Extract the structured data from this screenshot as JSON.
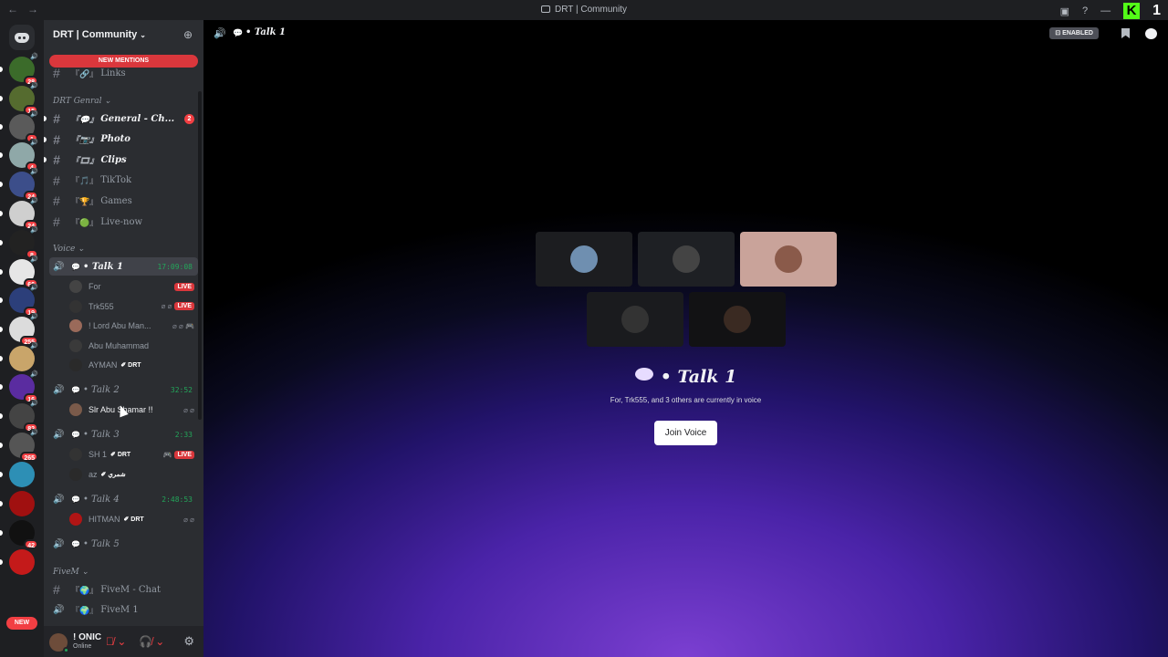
{
  "titlebar": {
    "title": "DRT | Community",
    "back": "←",
    "forward": "→",
    "k_logo": "K",
    "k_count": "1"
  },
  "servers": [
    {
      "badge": "28",
      "color": "#3b6b2a",
      "top": 0
    },
    {
      "badge": "15",
      "color": "#556b2f",
      "top": 0
    },
    {
      "badge": "1",
      "color": "#5a5a5a",
      "top": 0
    },
    {
      "badge": "4",
      "color": "#8fa8a8",
      "top": 0
    },
    {
      "badge": "24",
      "color": "#3c4e8a",
      "top": 0
    },
    {
      "badge": "24",
      "color": "#cfcfcf",
      "top": 0
    },
    {
      "badge": "8",
      "color": "#222",
      "top": 0
    },
    {
      "badge": "66",
      "color": "#e6e6e6",
      "top": 0
    },
    {
      "badge": "19",
      "color": "#2c3f7a",
      "top": 0
    },
    {
      "badge": "255",
      "color": "#dcdcdc",
      "top": 0
    },
    {
      "badge": "",
      "color": "#c9a56a",
      "top": 0
    },
    {
      "badge": "16",
      "color": "#5a2ca0",
      "top": 0
    },
    {
      "badge": "82",
      "color": "#444",
      "top": 0
    },
    {
      "badge": "265",
      "color": "#555",
      "top": 0
    },
    {
      "badge": "",
      "color": "#2d8fb5",
      "top": 0
    },
    {
      "badge": "",
      "color": "#a01010",
      "top": 0
    },
    {
      "badge": "42",
      "color": "#111",
      "top": 0
    },
    {
      "badge": "",
      "color": "#c41a1a",
      "top": 0
    }
  ],
  "new_label": "NEW",
  "guild": {
    "name": "DRT | Community"
  },
  "new_mentions": "NEW MENTIONS",
  "top_channels": [
    {
      "emoji": "『🔗』",
      "name": "Links"
    }
  ],
  "categories": {
    "general": "DRT Genral",
    "voice": "Voice",
    "fivem": "FiveM"
  },
  "general_channels": [
    {
      "emoji": "『💬』",
      "name": "General - Ch...",
      "count": "2",
      "unread": true
    },
    {
      "emoji": "『📷』",
      "name": "Photo",
      "count": "",
      "unread": true
    },
    {
      "emoji": "『🎞』",
      "name": "Clips",
      "count": "",
      "unread": true
    },
    {
      "emoji": "『🎵』",
      "name": "TikTok",
      "count": "",
      "unread": false
    },
    {
      "emoji": "『🏆』",
      "name": "Games",
      "count": "",
      "unread": false
    },
    {
      "emoji": "『🟢』",
      "name": "Live-now",
      "count": "",
      "unread": false
    }
  ],
  "voice": {
    "talk1": {
      "name": "• Talk 1",
      "time": "17:09:08"
    },
    "talk1_members": [
      {
        "name": "For",
        "tag": "",
        "live": "LIVE",
        "icons": "",
        "color": "#444"
      },
      {
        "name": "Trk555",
        "tag": "",
        "live": "LIVE",
        "icons": "⌀ ⌀",
        "color": "#333"
      },
      {
        "name": "! Lord Abu Man...",
        "tag": "",
        "live": "",
        "icons": "⌀ ⌀ 🎮",
        "color": "#9a6a5a"
      },
      {
        "name": "Abu Muhammad",
        "tag": "",
        "live": "",
        "icons": "",
        "color": "#3a3a3a"
      },
      {
        "name": "AYMAN",
        "tag": "✐ DRT",
        "live": "",
        "icons": "",
        "color": "#2a2a2a"
      }
    ],
    "talk2": {
      "name": "• Talk 2",
      "time": "32:52"
    },
    "talk2_members": [
      {
        "name": "Slr Abu Shamar !!",
        "tag": "",
        "live": "",
        "icons": "⌀ ⌀",
        "color": "#7a5a4a"
      }
    ],
    "talk3": {
      "name": "• Talk 3",
      "time": "2:33"
    },
    "talk3_members": [
      {
        "name": "SH 1",
        "tag": "✐ DRT",
        "live": "LIVE",
        "icons": "🎮",
        "color": "#333"
      },
      {
        "name": "az",
        "tag": "✐ شمري",
        "live": "",
        "icons": "",
        "color": "#2a2a2a"
      }
    ],
    "talk4": {
      "name": "• Talk 4",
      "time": "2:48:53"
    },
    "talk4_members": [
      {
        "name": "HITMAN",
        "tag": "✐ DRT",
        "live": "",
        "icons": "⌀ ⌀",
        "color": "#b01515"
      }
    ],
    "talk5": {
      "name": "• Talk 5",
      "time": ""
    }
  },
  "fivem_channels": [
    {
      "emoji": "『🌍』",
      "name": "FiveM - Chat"
    },
    {
      "emoji": "『🌍』",
      "name": "FiveM 1"
    }
  ],
  "user": {
    "name": "! ONIC",
    "status": "Online"
  },
  "main": {
    "channel": "• Talk 1",
    "enabled": "ENABLED",
    "heading": "• Talk 1",
    "subtitle": "For, Trk555, and 3 others are currently in voice",
    "join": "Join Voice",
    "tiles": [
      {
        "bg": "#1c1d20",
        "av": "#6f8fb0"
      },
      {
        "bg": "#1e2024",
        "av": "#444"
      },
      {
        "bg": "#c9a39a",
        "av": "#8a5a4a"
      },
      {
        "bg": "#1a1b1e",
        "av": "#333"
      },
      {
        "bg": "#121214",
        "av": "#3a2a22"
      }
    ]
  }
}
